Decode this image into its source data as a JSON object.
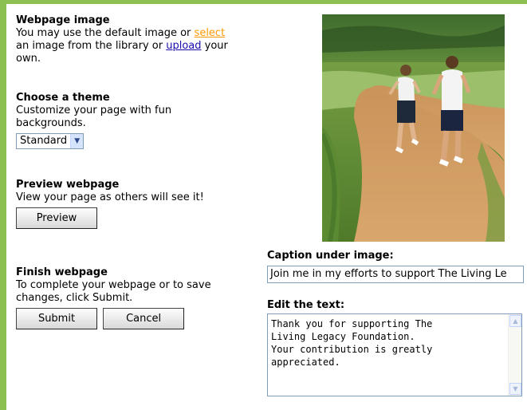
{
  "image_section": {
    "title": "Webpage image",
    "text_before": "You may use the default image or",
    "select_link": "select",
    "text_middle": "an image from the library or",
    "upload_link": "upload",
    "text_after": "your own."
  },
  "theme_section": {
    "title": "Choose a theme",
    "description": "Customize your page with fun backgrounds.",
    "selected_theme": "Standard",
    "dropdown_icon": "chevron-down-icon"
  },
  "preview_section": {
    "title": "Preview webpage",
    "description": "View your page as others will see it!",
    "button_label": "Preview"
  },
  "finish_section": {
    "title": "Finish webpage",
    "description": "To complete your webpage or to save changes, click Submit.",
    "submit_label": "Submit",
    "cancel_label": "Cancel"
  },
  "caption": {
    "label": "Caption under image:",
    "value": "Join me in my efforts to support The Living Le"
  },
  "body_text": {
    "label": "Edit the text:",
    "value": "Thank you for supporting The\nLiving Legacy Foundation.\nYour contribution is greatly\nappreciated."
  },
  "colors": {
    "frame_green": "#8cc152",
    "visited_link": "#ff9900",
    "link": "#1a0dab"
  }
}
